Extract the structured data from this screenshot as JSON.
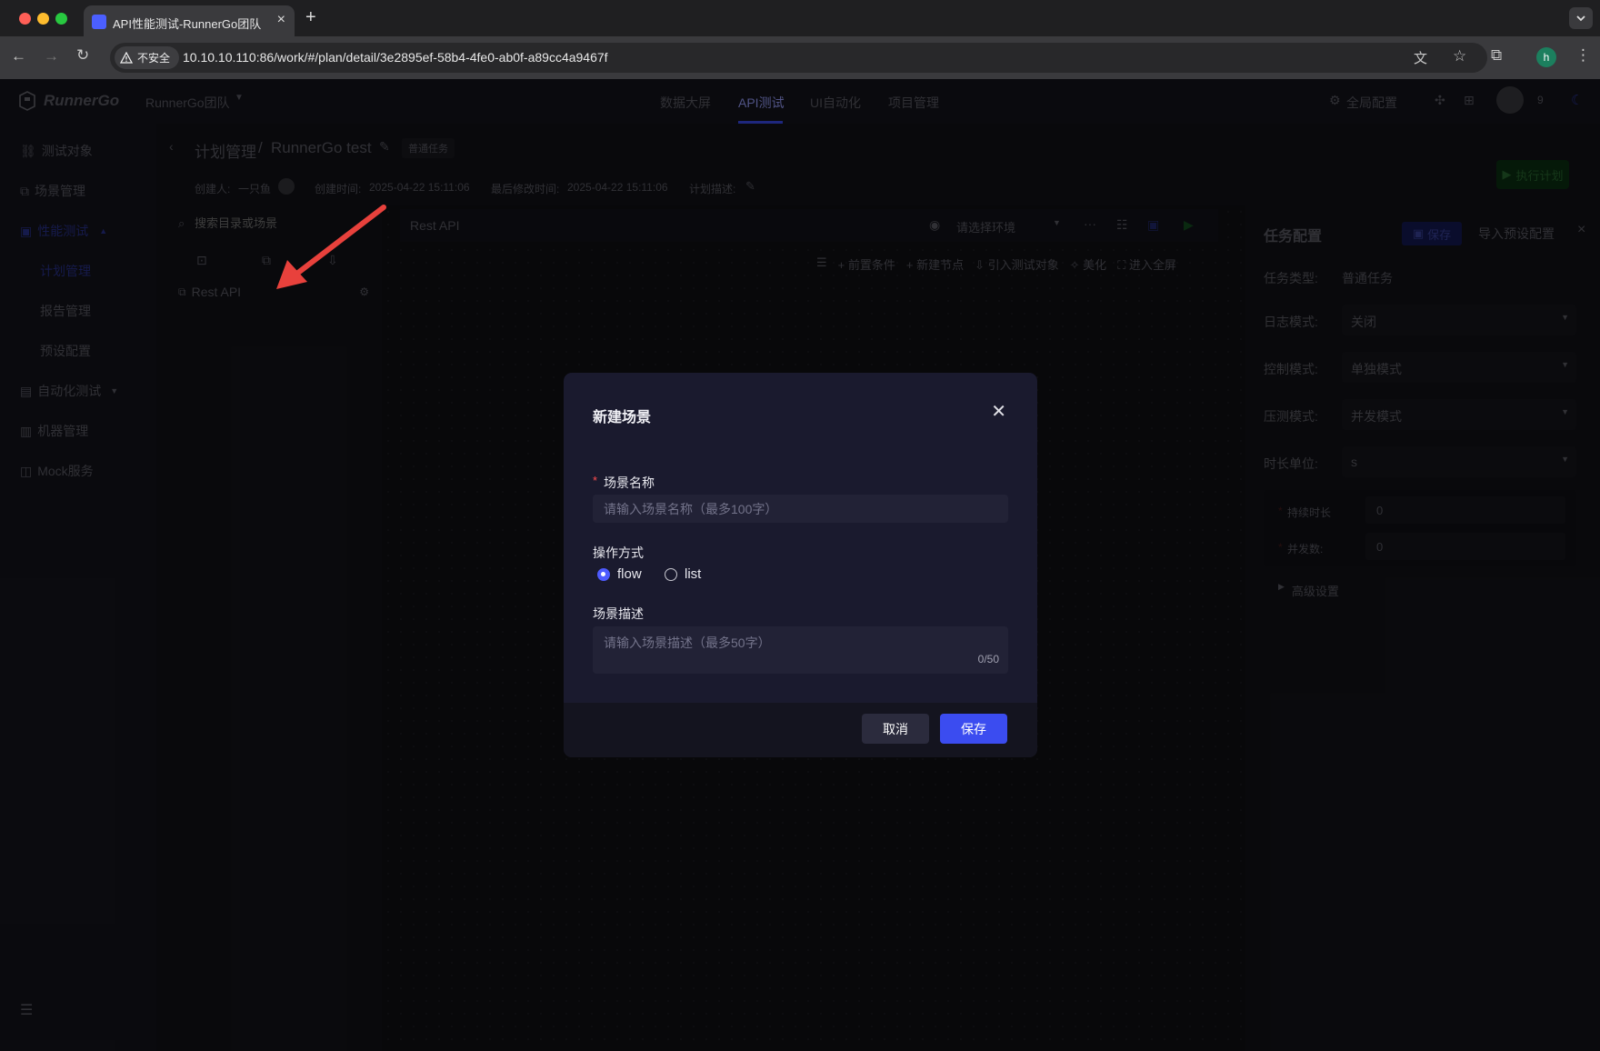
{
  "browser": {
    "tab_title": "API性能测试-RunnerGo团队",
    "insecure_label": "不安全",
    "url": "10.10.10.110:86/work/#/plan/detail/3e2895ef-58b4-4fe0-ab0f-a89cc4a9467f",
    "profile_initial": "h"
  },
  "header": {
    "logo_text": "RunnerGo",
    "team": "RunnerGo团队",
    "nav": [
      "数据大屏",
      "API测试",
      "UI自动化",
      "项目管理"
    ],
    "active_nav": "API测试",
    "global_config": "全局配置",
    "badge_count": "9"
  },
  "sidebar": {
    "items": [
      "测试对象",
      "场景管理",
      "性能测试",
      "自动化测试",
      "机器管理",
      "Mock服务"
    ],
    "sub_items": [
      "计划管理",
      "报告管理",
      "预设配置"
    ]
  },
  "plan": {
    "breadcrumb_root": "计划管理",
    "separator": "/",
    "name": "RunnerGo test",
    "task_tag": "普通任务",
    "creator_label": "创建人:",
    "creator": "一只鱼",
    "created_label": "创建时间:",
    "created": "2025-04-22 15:11:06",
    "modified_label": "最后修改时间:",
    "modified": "2025-04-22 15:11:06",
    "desc_label": "计划描述:",
    "run_button": "执行计划"
  },
  "tree": {
    "search_placeholder": "搜索目录或场景",
    "items": [
      "Rest API"
    ]
  },
  "canvas": {
    "scene_name": "Rest API",
    "env_placeholder": "请选择环境",
    "actions": [
      "前置条件",
      "新建节点",
      "引入测试对象",
      "美化",
      "进入全屏"
    ]
  },
  "task_config": {
    "title": "任务配置",
    "save": "保存",
    "import_preset": "导入预设配置",
    "task_type_label": "任务类型:",
    "task_type": "普通任务",
    "log_mode_label": "日志模式:",
    "log_mode": "关闭",
    "control_mode_label": "控制模式:",
    "control_mode": "单独模式",
    "stress_mode_label": "压测模式:",
    "stress_mode": "并发模式",
    "duration_unit_label": "时长单位:",
    "duration_unit": "s",
    "duration_label": "持续时长",
    "duration_value": "0",
    "concurrency_label": "并发数:",
    "concurrency_value": "0",
    "advanced": "高级设置"
  },
  "modal": {
    "title": "新建场景",
    "name_label": "场景名称",
    "required_mark": "*",
    "name_placeholder": "请输入场景名称（最多100字）",
    "mode_label": "操作方式",
    "mode_options": [
      "flow",
      "list"
    ],
    "selected_mode": "flow",
    "desc_label": "场景描述",
    "desc_placeholder": "请输入场景描述（最多50字）",
    "desc_counter": "0/50",
    "cancel": "取消",
    "save": "保存"
  },
  "colors": {
    "accent": "#3b4cf0",
    "annotation_arrow": "#e8413c",
    "run_green": "#27b03a"
  }
}
